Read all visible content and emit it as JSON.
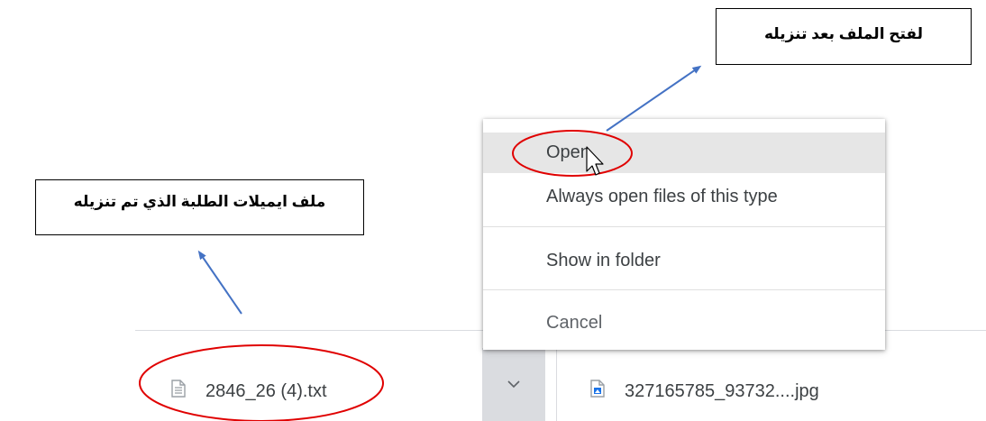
{
  "callouts": {
    "open_after_download": "لفتح الملف بعد تنزيله",
    "downloaded_emails_file": "ملف ايميلات الطلبة الذي تم تنزيله"
  },
  "context_menu": {
    "items": [
      {
        "label": "Open",
        "highlighted": true
      },
      {
        "label": "Always open files of this type"
      },
      {
        "label": "Show in folder"
      },
      {
        "label": "Cancel",
        "disabled": true
      }
    ]
  },
  "download_shelf": {
    "items": [
      {
        "filename": "2846_26 (4).txt",
        "icon": "text-file-icon"
      },
      {
        "filename": "327165785_93732....jpg",
        "icon": "image-file-icon"
      }
    ]
  },
  "colors": {
    "annotation_ellipse": "#e00000",
    "arrow": "#4472c4",
    "menu_highlight": "#e6e6e6",
    "chevron_button_bg": "#dadce0"
  }
}
